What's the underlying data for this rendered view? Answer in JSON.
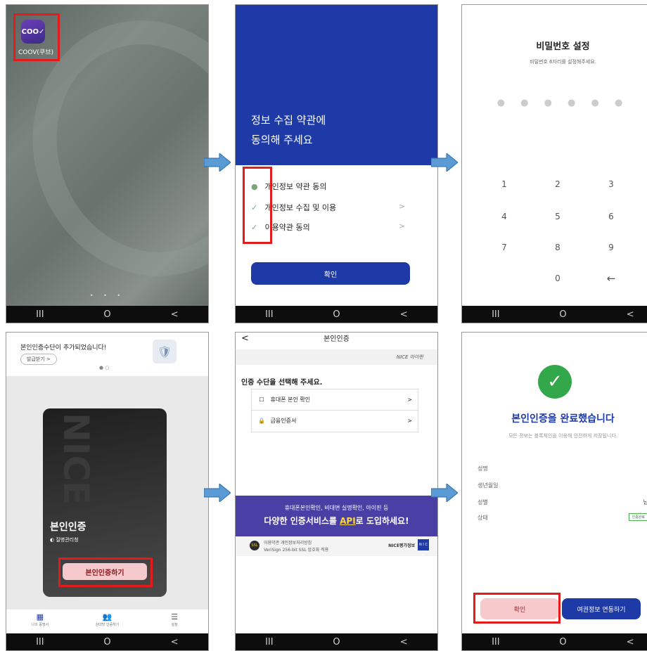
{
  "navbar": {
    "recent": "III",
    "home": "O",
    "back": "<"
  },
  "screen1": {
    "app_icon_text": "COO✓",
    "app_label": "COOV(쿠브)",
    "page_dots": "• • •"
  },
  "screen2": {
    "header_title": "정보 수집 약관에\n동의해 주세요",
    "items": [
      {
        "check": "●",
        "label": "개인정보 약관 동의",
        "chev": ""
      },
      {
        "check": "✓",
        "label": "개인정보 수집 및 이용",
        "chev": ">"
      },
      {
        "check": "✓",
        "label": "이용약관 동의",
        "chev": ">"
      }
    ],
    "confirm": "확인"
  },
  "screen3": {
    "title": "비밀번호 설정",
    "subtitle": "비밀번호 6자리를 설정해주세요.",
    "pin_dots": "● ● ● ● ● ●",
    "keys": [
      "1",
      "2",
      "3",
      "4",
      "5",
      "6",
      "7",
      "8",
      "9",
      "0",
      "←"
    ]
  },
  "screen4": {
    "banner": "본인인증수단이 추가되었습니다!",
    "banner_button": "발급받기 >",
    "pager": "● ○",
    "card_watermark": "NICE",
    "card_title": "본인인증",
    "card_org": "질병관리청",
    "card_button": "본인인증하기",
    "tabs": [
      "나의 증명서",
      "상대방 인증하기",
      "설정"
    ]
  },
  "screen5": {
    "back": "<",
    "title": "본인인증",
    "nice_logo": "NICE 아이핀",
    "question": "인증 수단을 선택해 주세요.",
    "options": [
      {
        "icon": "☐",
        "label": "휴대폰 본인 확인",
        "chev": ">"
      },
      {
        "icon": "🔒",
        "label": "금융인증서",
        "chev": ">"
      }
    ],
    "ad_line1": "휴대폰본인확인, 비대면 실명확인, 아이핀 등",
    "ad_line2_pre": "다양한 인증서비스를 ",
    "ad_line2_api": "API",
    "ad_line2_post": "로 도입하세요!",
    "foot_icon": "SSL",
    "foot_line1": "이용약관   개인정보처리방침",
    "foot_line2": "VeriSign 256-bit SSL 암호화 적용",
    "foot_logo": "NICE평가정보",
    "foot_badge": "N I C E"
  },
  "screen6": {
    "check": "✓",
    "title": "본인인증을 완료했습니다",
    "subtitle": "모든 정보는 블록체인을 이용해 안전하게 저장됩니다.",
    "fields": [
      {
        "label": "성명",
        "value": ""
      },
      {
        "label": "생년월일",
        "value": ""
      },
      {
        "label": "성별",
        "value": "남"
      },
      {
        "label": "상태",
        "value": "인증완료"
      }
    ],
    "confirm": "확인",
    "passport": "여권정보 연동하기"
  },
  "colors": {
    "accent": "#1e3aa6",
    "highlight": "#e31b1b",
    "arrow": "#5b9bd5"
  }
}
